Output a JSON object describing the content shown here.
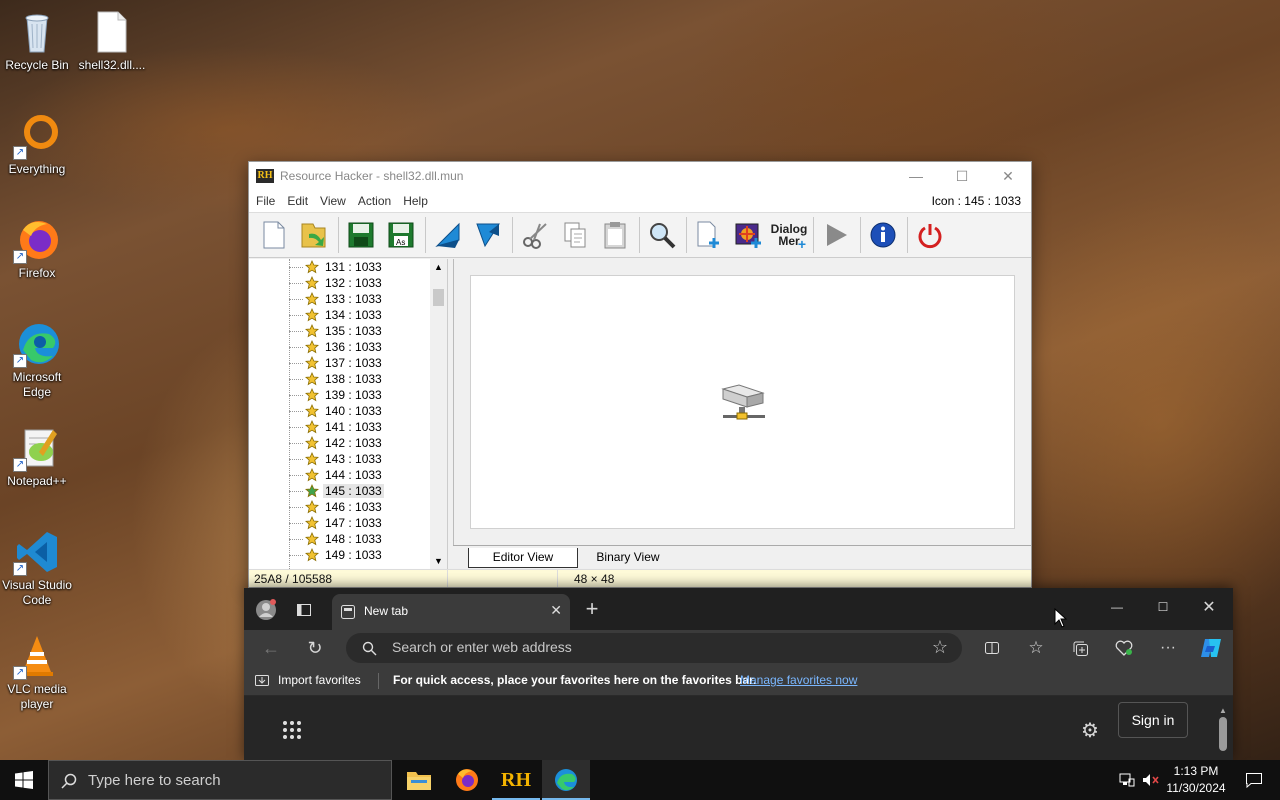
{
  "desktop": {
    "icons": [
      {
        "label": "Recycle Bin",
        "icon": "recycle-bin-icon"
      },
      {
        "label": "shell32.dll....",
        "icon": "file-icon"
      },
      {
        "label": "Everything",
        "icon": "everything-icon"
      },
      {
        "label": "Firefox",
        "icon": "firefox-icon"
      },
      {
        "label": "Microsoft Edge",
        "icon": "edge-icon"
      },
      {
        "label": "Notepad++",
        "icon": "notepad-plus-plus-icon"
      },
      {
        "label": "Visual Studio Code",
        "icon": "vscode-icon"
      },
      {
        "label": "VLC media player",
        "icon": "vlc-icon"
      }
    ]
  },
  "resource_hacker": {
    "logo": "RH",
    "title": "Resource Hacker - shell32.dll.mun",
    "menu": [
      "File",
      "Edit",
      "View",
      "Action",
      "Help"
    ],
    "resource_id": "Icon : 145 : 1033",
    "toolbar": {
      "dialog_menu_label_1": "Dialog",
      "dialog_menu_label_2": "Mer"
    },
    "tree_items": [
      "131 : 1033",
      "132 : 1033",
      "133 : 1033",
      "134 : 1033",
      "135 : 1033",
      "136 : 1033",
      "137 : 1033",
      "138 : 1033",
      "139 : 1033",
      "140 : 1033",
      "141 : 1033",
      "142 : 1033",
      "143 : 1033",
      "144 : 1033",
      "145 : 1033",
      "146 : 1033",
      "147 : 1033",
      "148 : 1033",
      "149 : 1033"
    ],
    "selected_item": "145 : 1033",
    "tabs": {
      "editor": "Editor View",
      "binary": "Binary View"
    },
    "status": {
      "offset": "25A8 / 105588",
      "size": "48 × 48"
    }
  },
  "edge": {
    "tab_title": "New tab",
    "address_placeholder": "Search or enter web address",
    "import_favorites": "Import favorites",
    "fav_hint": "For quick access, place your favorites here on the favorites bar.",
    "manage_link": "Manage favorites now",
    "sign_in": "Sign in",
    "link_color": "#7ab7ff"
  },
  "taskbar": {
    "search_placeholder": "Type here to search",
    "pinned": [
      "file-explorer-icon",
      "firefox-icon",
      "resource-hacker-icon",
      "edge-icon"
    ],
    "clock_time": "1:13 PM",
    "clock_date": "11/30/2024",
    "rh_label": "RH"
  }
}
